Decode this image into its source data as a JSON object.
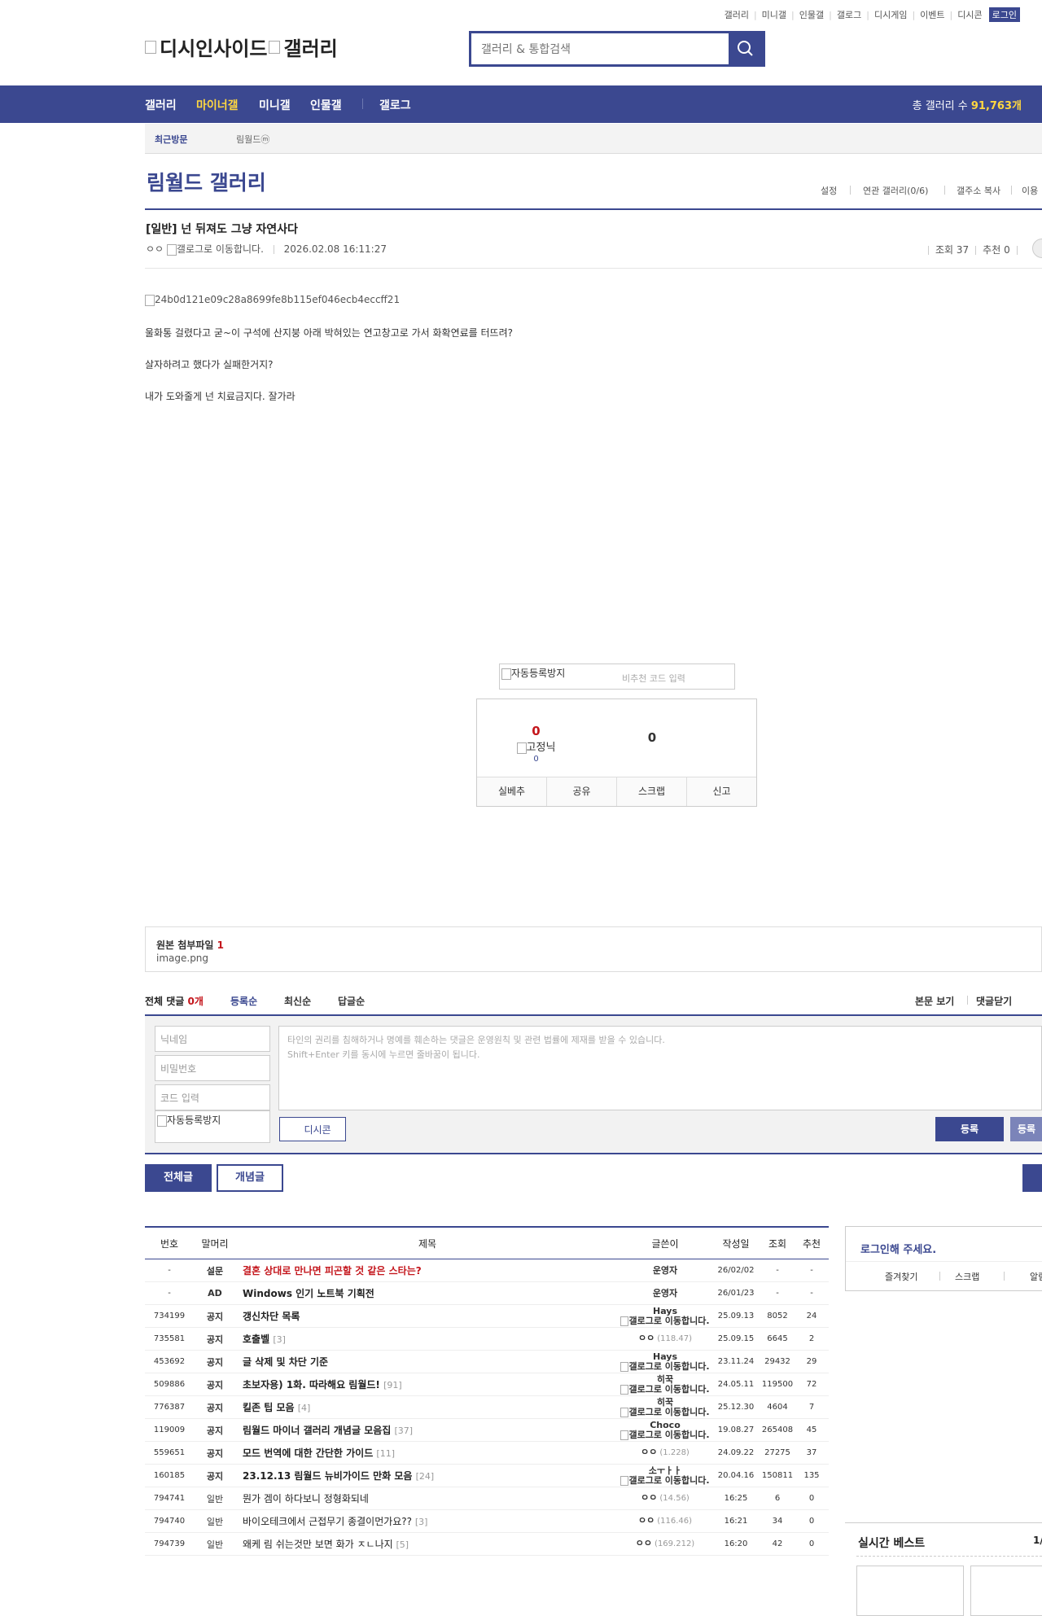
{
  "topmenu": [
    "갤러리",
    "미니갤",
    "인물갤",
    "갤로그",
    "디시게임",
    "이벤트",
    "디시콘"
  ],
  "login_label": "로그인",
  "logo": {
    "left": "디시인사이드",
    "right": "갤러리"
  },
  "search": {
    "placeholder": "갤러리 & 통합검색"
  },
  "gnb": {
    "items": [
      "갤러리",
      "마이너갤",
      "미니갤",
      "인물갤",
      "갤로그"
    ],
    "total_label": "총 갤러리 수",
    "total_value": "91,763개"
  },
  "recent": {
    "label": "최근방문",
    "item": "림월드ⓜ"
  },
  "gallery": {
    "title": "림월드 갤러리",
    "options": [
      "설정",
      "연관 갤러리(0/6)",
      "갤주소 복사",
      "이용"
    ]
  },
  "post": {
    "title": "[일반] 넌 뒤져도 그냥 자연사다",
    "writer": "ㅇㅇ",
    "gallog_alt": "갤로그로 이동합니다.",
    "date": "2026.02.08 16:11:27",
    "views": "조회 37",
    "recommend": "추천 0",
    "image_alt": "24b0d121e09c28a8699fe8b115ef046ecb4eccff21",
    "lines": [
      "울화통 걸렸다고 굳~이 구석에 산지붕 아래 박혀있는 연고창고로 가서 화확연료를 터뜨려?",
      "살자하려고 했다가 실패한거지?",
      "내가 도와줄게 넌 치료금지다. 잘가라"
    ]
  },
  "captcha": {
    "alt": "자동등록방지",
    "placeholder": "비추천 코드 입력"
  },
  "rec": {
    "up_count": "0",
    "fixed_label": "고정닉",
    "fixed_count": "0",
    "down_count": "0",
    "buttons": [
      "실베추",
      "공유",
      "스크랩",
      "신고"
    ]
  },
  "attach": {
    "label": "원본 첨부파일",
    "count": "1",
    "file": "image.png"
  },
  "comments": {
    "total_label": "전체 댓글",
    "total_count": "0개",
    "sorts": [
      "등록순",
      "최신순",
      "답글순"
    ],
    "right": [
      "본문 보기",
      "댓글닫기"
    ],
    "nick_placeholder": "닉네임",
    "pw_placeholder": "비밀번호",
    "code_placeholder": "코드 입력",
    "captcha_alt": "자동등록방지",
    "textarea_line1": "타인의 권리를 침해하거나 명예를 훼손하는 댓글은 운영원칙 및 관련 법률에 제재를 받을 수 있습니다.",
    "textarea_line2": "Shift+Enter 키를 동시에 누르면 줄바꿈이 됩니다.",
    "dccon": "디시콘",
    "submit": "등록",
    "submit2": "등록"
  },
  "tabs": {
    "all": "전체글",
    "concept": "개념글"
  },
  "list": {
    "headers": [
      "번호",
      "말머리",
      "제목",
      "글쓴이",
      "작성일",
      "조회",
      "추천"
    ],
    "rows": [
      {
        "no": "-",
        "head": "설문",
        "title": "결혼 상대로 만나면 피곤할 것 같은 스타는?",
        "cnt": "",
        "writer": "운영자",
        "ip": "",
        "gallog": "",
        "date": "26/02/02",
        "views": "-",
        "rec": "-"
      },
      {
        "no": "-",
        "head": "AD",
        "title": "Windows 인기 노트북 기획전",
        "cnt": "",
        "writer": "운영자",
        "ip": "",
        "gallog": "",
        "date": "26/01/23",
        "views": "-",
        "rec": "-"
      },
      {
        "no": "734199",
        "head": "공지",
        "title": "갱신차단 목록",
        "cnt": "",
        "writer": "Hays",
        "ip": "",
        "gallog": "갤로그로 이동합니다.",
        "date": "25.09.13",
        "views": "8052",
        "rec": "24"
      },
      {
        "no": "735581",
        "head": "공지",
        "title": "호출벨",
        "cnt": "[3]",
        "writer": "ㅇㅇ",
        "ip": "(118.47)",
        "gallog": "",
        "date": "25.09.15",
        "views": "6645",
        "rec": "2"
      },
      {
        "no": "453692",
        "head": "공지",
        "title": "글 삭제 및 차단 기준",
        "cnt": "",
        "writer": "Hays",
        "ip": "",
        "gallog": "갤로그로 이동합니다.",
        "date": "23.11.24",
        "views": "29432",
        "rec": "29"
      },
      {
        "no": "509886",
        "head": "공지",
        "title": "초보자용) 1화. 따라해요 림월드!",
        "cnt": "[91]",
        "writer": "히꾹",
        "ip": "",
        "gallog": "갤로그로 이동합니다.",
        "date": "24.05.11",
        "views": "119500",
        "rec": "72"
      },
      {
        "no": "776387",
        "head": "공지",
        "title": "킬존 팁 모음",
        "cnt": "[4]",
        "writer": "히꾹",
        "ip": "",
        "gallog": "갤로그로 이동합니다.",
        "date": "25.12.30",
        "views": "4604",
        "rec": "7"
      },
      {
        "no": "119009",
        "head": "공지",
        "title": "림월드 마이너 갤러리 개념글 모음집",
        "cnt": "[37]",
        "writer": "Choco",
        "ip": "",
        "gallog": "갤로그로 이동합니다.",
        "date": "19.08.27",
        "views": "265408",
        "rec": "45"
      },
      {
        "no": "559651",
        "head": "공지",
        "title": "모드 번역에 대한 간단한 가이드",
        "cnt": "[11]",
        "writer": "ㅇㅇ",
        "ip": "(1.228)",
        "gallog": "",
        "date": "24.09.22",
        "views": "27275",
        "rec": "37"
      },
      {
        "no": "160185",
        "head": "공지",
        "title": "23.12.13 림월드 뉴비가이드 만화 모음",
        "cnt": "[24]",
        "writer": "소ㅜㅏㅏ",
        "ip": "",
        "gallog": "갤로그로 이동합니다.",
        "date": "20.04.16",
        "views": "150811",
        "rec": "135"
      },
      {
        "no": "794741",
        "head": "일반",
        "title": "뭔가 겜이 하다보니 정형화되네",
        "cnt": "",
        "writer": "ㅇㅇ",
        "ip": "(14.56)",
        "gallog": "",
        "date": "16:25",
        "views": "6",
        "rec": "0"
      },
      {
        "no": "794740",
        "head": "일반",
        "title": "바이오테크에서 근접무기 종결이먼가요??",
        "cnt": "[3]",
        "writer": "ㅇㅇ",
        "ip": "(116.46)",
        "gallog": "",
        "date": "16:21",
        "views": "34",
        "rec": "0"
      },
      {
        "no": "794739",
        "head": "일반",
        "title": "왜케 림 쉬는것만 보면 화가 ㅈㄴ나지",
        "cnt": "[5]",
        "writer": "ㅇㅇ",
        "ip": "(169.212)",
        "gallog": "",
        "date": "16:20",
        "views": "42",
        "rec": "0"
      }
    ]
  },
  "side": {
    "login_prompt": "로그인해 주세요.",
    "links": [
      "즐겨찾기",
      "스크랩",
      "알림"
    ],
    "realtime_title": "실시간 베스트",
    "realtime_page": "1/"
  },
  "colors": {
    "navy": "#3b4890",
    "yellow": "#ffd740",
    "red": "#c4161c"
  }
}
